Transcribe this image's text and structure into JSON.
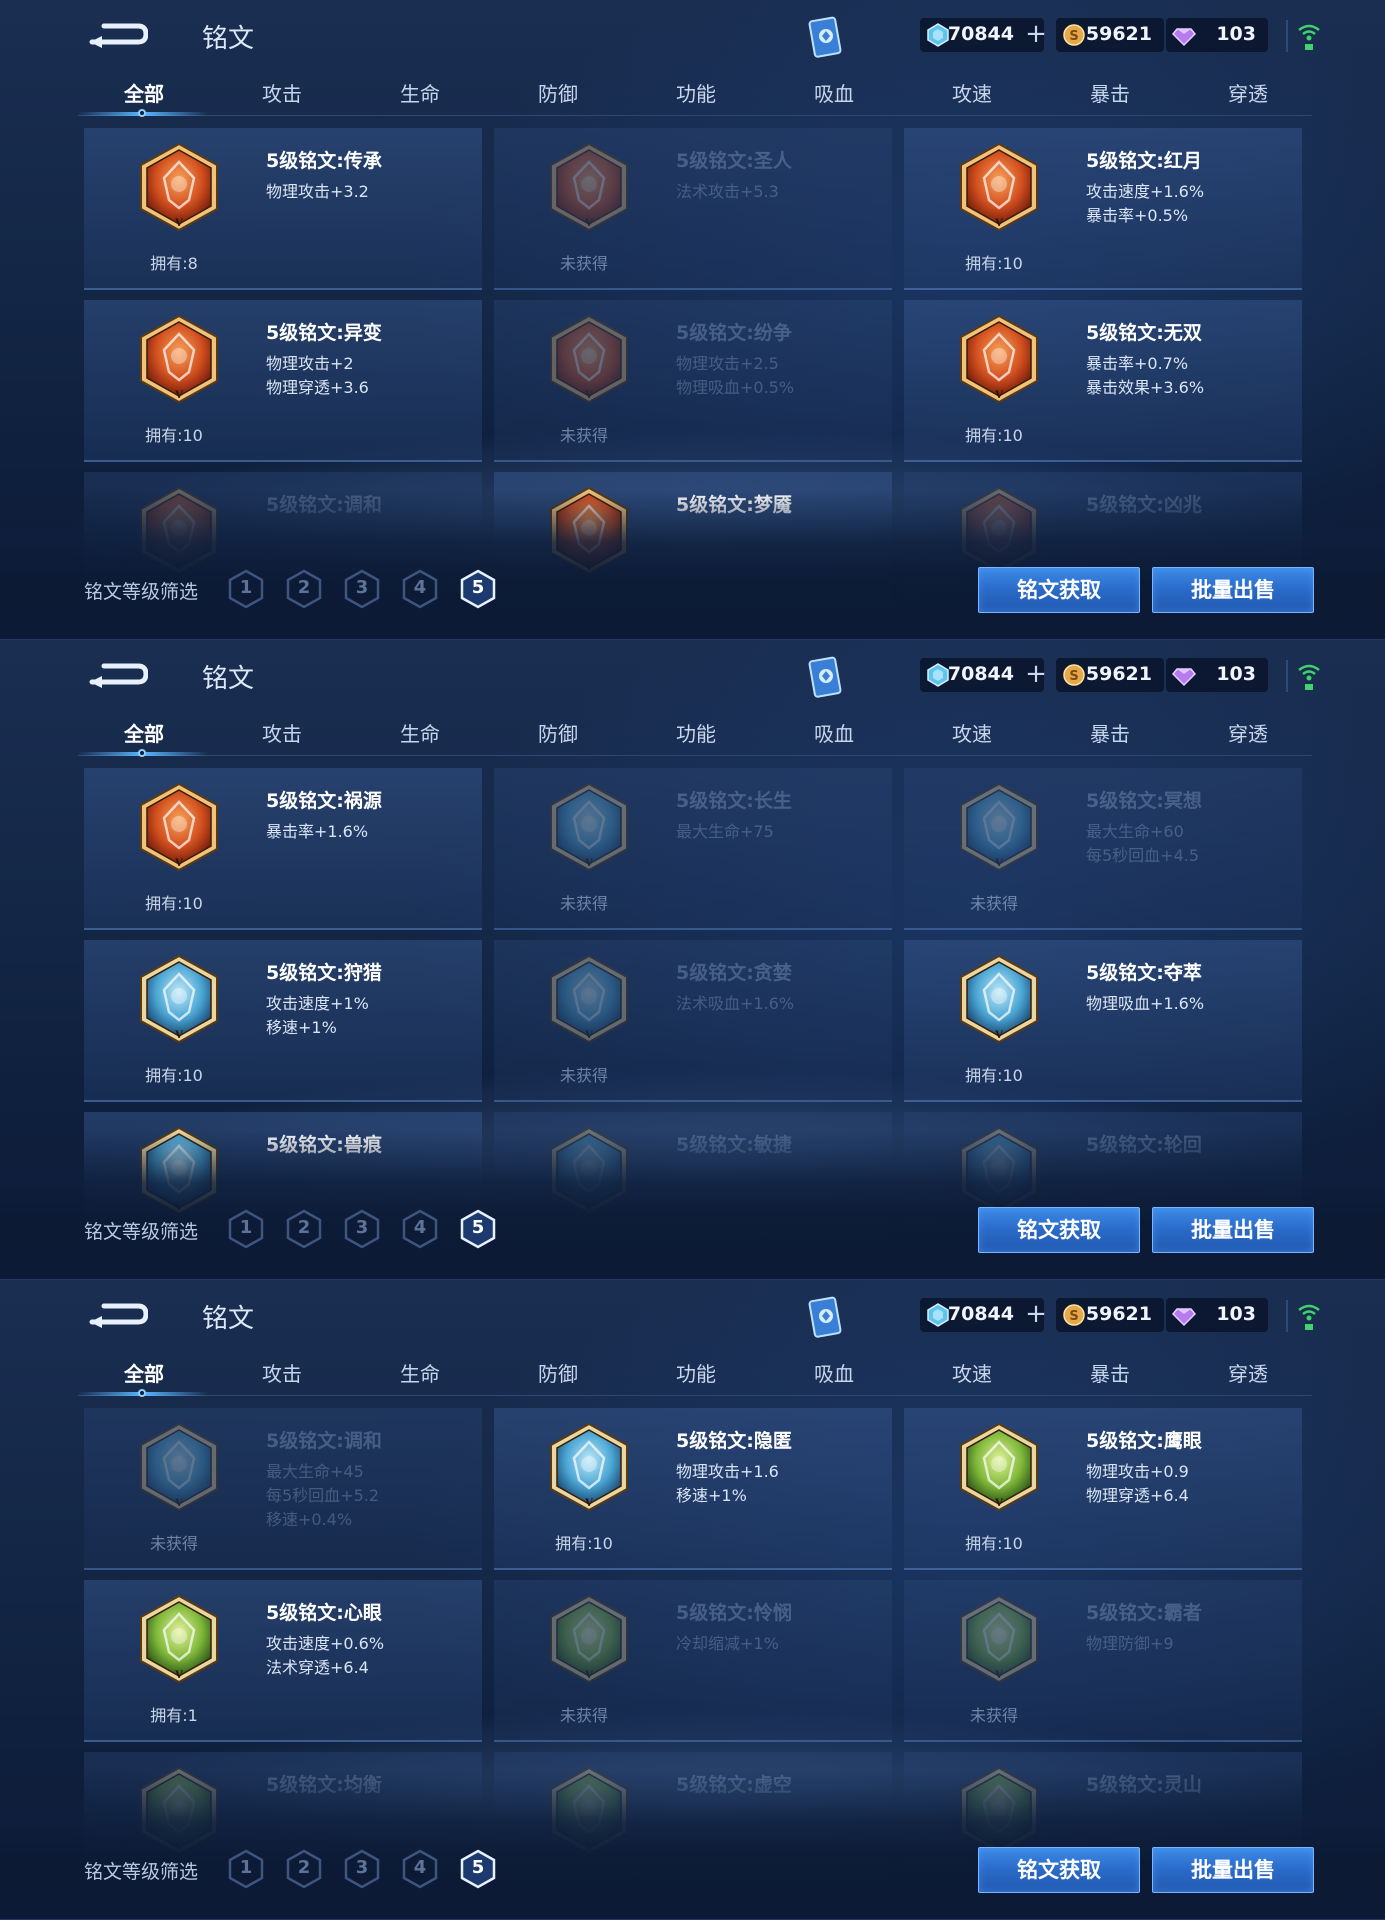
{
  "header": {
    "title": "铭文"
  },
  "resources": {
    "diamond": "70844",
    "gold": "59621",
    "gem": "103"
  },
  "tabs": [
    "全部",
    "攻击",
    "生命",
    "防御",
    "功能",
    "吸血",
    "攻速",
    "暴击",
    "穿透"
  ],
  "active_tab": "全部",
  "footer": {
    "filter_label": "铭文等级筛选",
    "levels": [
      "1",
      "2",
      "3",
      "4",
      "5"
    ],
    "active_level": "5",
    "get_button": "铭文获取",
    "sell_button": "批量出售"
  },
  "colors": {
    "accent": "#3d8ae6",
    "background": "#132645",
    "gem_orange": "#e86a2a",
    "gem_blue": "#6ec4e6",
    "gem_green": "#8bc53f"
  },
  "screens": [
    {
      "cards": [
        {
          "name": "5级铭文:传承",
          "stats": [
            "物理攻击+3.2"
          ],
          "own": "拥有:8",
          "locked": false,
          "color": "orange",
          "icon": "inheritance-rune-icon"
        },
        {
          "name": "5级铭文:圣人",
          "stats": [
            "法术攻击+5.3"
          ],
          "own": "未获得",
          "locked": true,
          "color": "orange",
          "icon": "sage-rune-icon"
        },
        {
          "name": "5级铭文:红月",
          "stats": [
            "攻击速度+1.6%",
            "暴击率+0.5%"
          ],
          "own": "拥有:10",
          "locked": false,
          "color": "orange",
          "icon": "red-moon-rune-icon"
        },
        {
          "name": "5级铭文:异变",
          "stats": [
            "物理攻击+2",
            "物理穿透+3.6"
          ],
          "own": "拥有:10",
          "locked": false,
          "color": "orange",
          "icon": "mutation-rune-icon"
        },
        {
          "name": "5级铭文:纷争",
          "stats": [
            "物理攻击+2.5",
            "物理吸血+0.5%"
          ],
          "own": "未获得",
          "locked": true,
          "color": "orange",
          "icon": "strife-rune-icon"
        },
        {
          "name": "5级铭文:无双",
          "stats": [
            "暴击率+0.7%",
            "暴击效果+3.6%"
          ],
          "own": "拥有:10",
          "locked": false,
          "color": "orange",
          "icon": "peerless-rune-icon"
        }
      ],
      "partial": [
        {
          "name": "5级铭文:调和",
          "locked": true,
          "color": "orange"
        },
        {
          "name": "5级铭文:梦魇",
          "locked": false,
          "color": "orange"
        },
        {
          "name": "5级铭文:凶兆",
          "locked": true,
          "color": "orange"
        }
      ]
    },
    {
      "cards": [
        {
          "name": "5级铭文:祸源",
          "stats": [
            "暴击率+1.6%"
          ],
          "own": "拥有:10",
          "locked": false,
          "color": "orange",
          "icon": "calamity-rune-icon"
        },
        {
          "name": "5级铭文:长生",
          "stats": [
            "最大生命+75"
          ],
          "own": "未获得",
          "locked": true,
          "color": "blue",
          "icon": "longevity-rune-icon"
        },
        {
          "name": "5级铭文:冥想",
          "stats": [
            "最大生命+60",
            "每5秒回血+4.5"
          ],
          "own": "未获得",
          "locked": true,
          "color": "blue",
          "icon": "meditation-rune-icon"
        },
        {
          "name": "5级铭文:狩猎",
          "stats": [
            "攻击速度+1%",
            "移速+1%"
          ],
          "own": "拥有:10",
          "locked": false,
          "color": "blue",
          "icon": "hunting-rune-icon"
        },
        {
          "name": "5级铭文:贪婪",
          "stats": [
            "法术吸血+1.6%"
          ],
          "own": "未获得",
          "locked": true,
          "color": "blue",
          "icon": "greed-rune-icon"
        },
        {
          "name": "5级铭文:夺萃",
          "stats": [
            "物理吸血+1.6%"
          ],
          "own": "拥有:10",
          "locked": false,
          "color": "blue",
          "icon": "essence-rune-icon"
        }
      ],
      "partial": [
        {
          "name": "5级铭文:兽痕",
          "locked": false,
          "color": "blue"
        },
        {
          "name": "5级铭文:敏捷",
          "locked": true,
          "color": "blue"
        },
        {
          "name": "5级铭文:轮回",
          "locked": true,
          "color": "blue"
        }
      ]
    },
    {
      "cards": [
        {
          "name": "5级铭文:调和",
          "stats": [
            "最大生命+45",
            "每5秒回血+5.2",
            "移速+0.4%"
          ],
          "own": "未获得",
          "locked": true,
          "color": "blue",
          "icon": "harmony-rune-icon"
        },
        {
          "name": "5级铭文:隐匿",
          "stats": [
            "物理攻击+1.6",
            "移速+1%"
          ],
          "own": "拥有:10",
          "locked": false,
          "color": "blue",
          "icon": "stealth-rune-icon"
        },
        {
          "name": "5级铭文:鹰眼",
          "stats": [
            "物理攻击+0.9",
            "物理穿透+6.4"
          ],
          "own": "拥有:10",
          "locked": false,
          "color": "green",
          "icon": "hawk-eye-rune-icon"
        },
        {
          "name": "5级铭文:心眼",
          "stats": [
            "攻击速度+0.6%",
            "法术穿透+6.4"
          ],
          "own": "拥有:1",
          "locked": false,
          "color": "green",
          "icon": "mind-eye-rune-icon"
        },
        {
          "name": "5级铭文:怜悯",
          "stats": [
            "冷却缩减+1%"
          ],
          "own": "未获得",
          "locked": true,
          "color": "green",
          "icon": "mercy-rune-icon"
        },
        {
          "name": "5级铭文:霸者",
          "stats": [
            "物理防御+9"
          ],
          "own": "未获得",
          "locked": true,
          "color": "green",
          "icon": "overlord-rune-icon"
        }
      ],
      "partial": [
        {
          "name": "5级铭文:均衡",
          "locked": true,
          "color": "green"
        },
        {
          "name": "5级铭文:虚空",
          "locked": true,
          "color": "green"
        },
        {
          "name": "5级铭文:灵山",
          "locked": true,
          "color": "green"
        }
      ]
    }
  ]
}
